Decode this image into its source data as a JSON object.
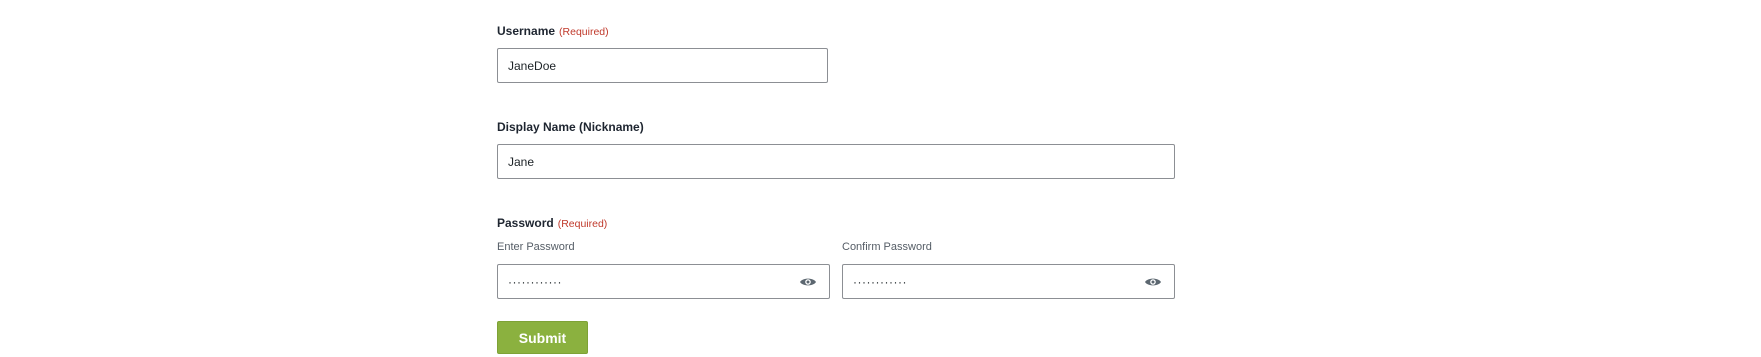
{
  "username": {
    "label": "Username",
    "required_text": "(Required)",
    "value": "JaneDoe"
  },
  "display_name": {
    "label": "Display Name (Nickname)",
    "value": "Jane"
  },
  "password": {
    "label": "Password",
    "required_text": "(Required)",
    "enter_label": "Enter Password",
    "enter_value": "············",
    "confirm_label": "Confirm Password",
    "confirm_value": "············",
    "toggle_icon": "eye-icon"
  },
  "submit_label": "Submit",
  "colors": {
    "required": "#c0392b",
    "submit_bg": "#8bb13f",
    "border": "#8c8f94"
  }
}
